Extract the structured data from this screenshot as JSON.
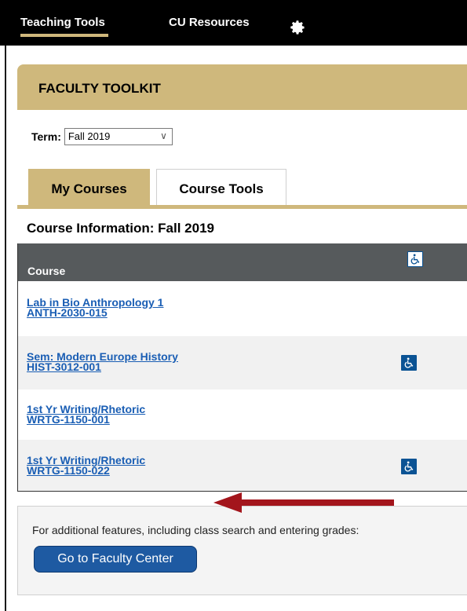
{
  "topnav": {
    "tabs": [
      {
        "label": "Teaching Tools",
        "active": true
      },
      {
        "label": "CU Resources",
        "active": false
      }
    ],
    "settings_icon": "gear-icon"
  },
  "toolkit": {
    "title": "FACULTY TOOLKIT",
    "term_label": "Term:",
    "term_value": "Fall 2019",
    "tabs": [
      {
        "label": "My Courses",
        "active": true
      },
      {
        "label": "Course Tools",
        "active": false
      }
    ],
    "course_info_title": "Course Information: Fall 2019",
    "table": {
      "column_course": "Course",
      "column_accessibility_icon": "wheelchair-icon",
      "rows": [
        {
          "title": "Lab in Bio Anthropology 1",
          "code": "ANTH-2030-015",
          "accessibility": false
        },
        {
          "title": "Sem: Modern Europe History",
          "code": "HIST-3012-001",
          "accessibility": true
        },
        {
          "title": "1st Yr Writing/Rhetoric",
          "code": "WRTG-1150-001",
          "accessibility": false
        },
        {
          "title": "1st Yr Writing/Rhetoric",
          "code": "WRTG-1150-022",
          "accessibility": true
        }
      ]
    },
    "footer": {
      "text": "For additional features, including class search and entering grades:",
      "button_label": "Go to Faculty Center"
    }
  },
  "colors": {
    "gold": "#cfb87c",
    "table_header": "#565a5c",
    "link": "#1a5eb4",
    "button": "#1e5aa2",
    "arrow": "#a3151c"
  }
}
